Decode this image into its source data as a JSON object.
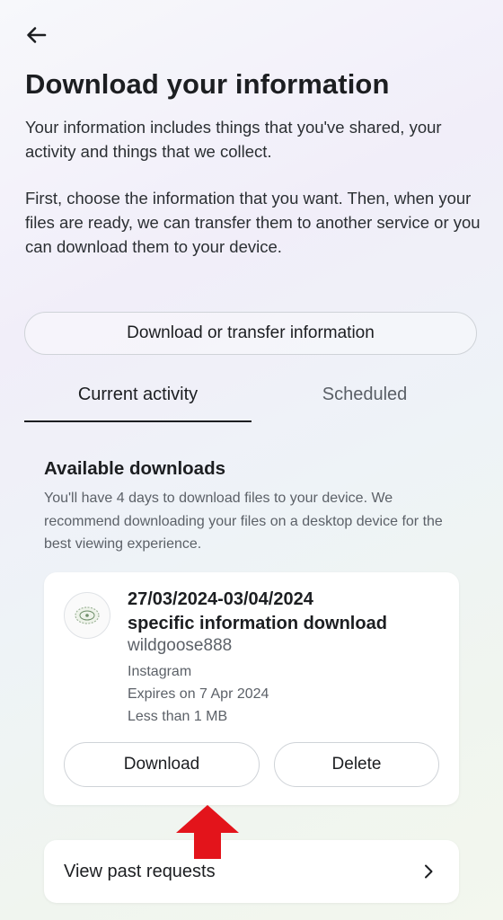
{
  "header": {
    "back_icon": "arrow-left-icon"
  },
  "page": {
    "title": "Download your information",
    "intro": "Your information includes things that you've shared, your activity and things that we collect.",
    "instructions": "First, choose the information that you want. Then, when your files are ready, we can transfer them to another service or you can download them to your device."
  },
  "actions": {
    "download_transfer_label": "Download or transfer information"
  },
  "tabs": [
    {
      "label": "Current activity",
      "selected": true
    },
    {
      "label": "Scheduled",
      "selected": false
    }
  ],
  "downloads": {
    "title": "Available downloads",
    "description": "You'll have 4 days to download files to your device. We recommend downloading your files on a desktop device for the best viewing experience.",
    "items": [
      {
        "date_range": "27/03/2024-03/04/2024",
        "type_label": "specific information download",
        "username": "wildgoose888",
        "platform": "Instagram",
        "expires": "Expires on 7 Apr 2024",
        "size": "Less than 1 MB",
        "download_label": "Download",
        "delete_label": "Delete"
      }
    ]
  },
  "past_requests": {
    "label": "View past requests",
    "icon": "chevron-right-icon"
  },
  "colors": {
    "annotation_arrow": "#e3141b",
    "tab_indicator": "#1c1e21",
    "text_primary": "#1c1e21",
    "text_secondary": "#5c6168"
  }
}
